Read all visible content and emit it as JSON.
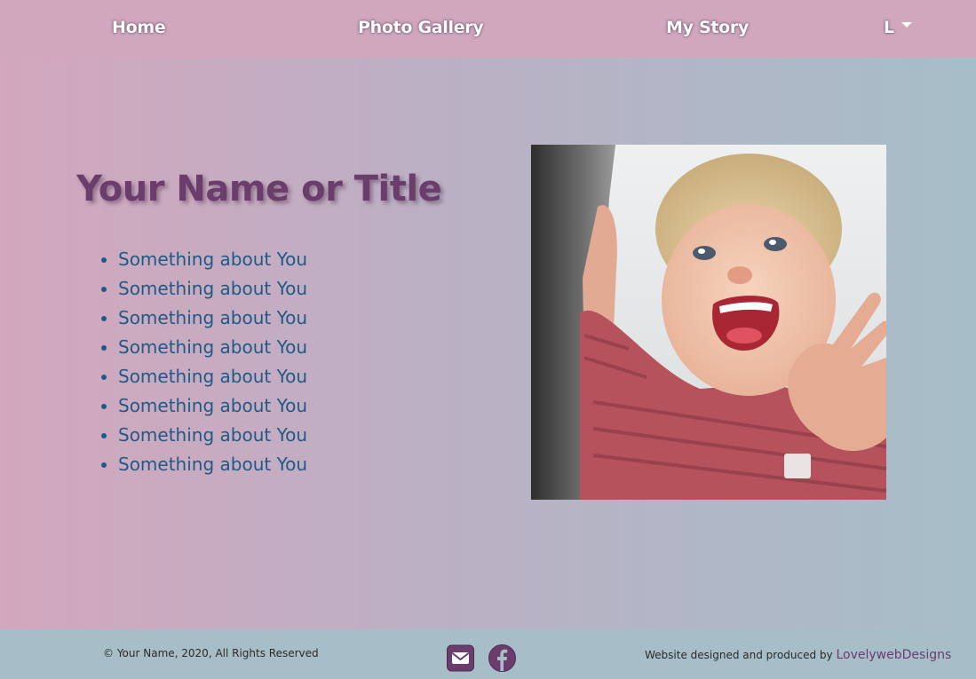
{
  "nav": {
    "home": "Home",
    "gallery": "Photo Gallery",
    "story": "My Story",
    "language": "L"
  },
  "hero": {
    "title": "Your Name or Title",
    "items": [
      "Something about You",
      "Something about You",
      "Something about You",
      "Something about You",
      "Something about You",
      "Something about You",
      "Something about You",
      "Something about You"
    ],
    "photo_icon": "photo-of-laughing-toddler"
  },
  "footer": {
    "copyright": "© Your Name, 2020, All Rights Reserved",
    "mail_icon": "envelope-icon",
    "facebook_icon": "facebook-icon",
    "credit_prefix": "Website designed and produced by",
    "credit_link": "LovelywebDesigns"
  },
  "colors": {
    "nav_bg": "#d1a7be",
    "footer_bg": "#a7bec8",
    "title": "#6a3d6c",
    "list_text": "#1f5a86",
    "icon_bg": "#6a3d6c"
  }
}
